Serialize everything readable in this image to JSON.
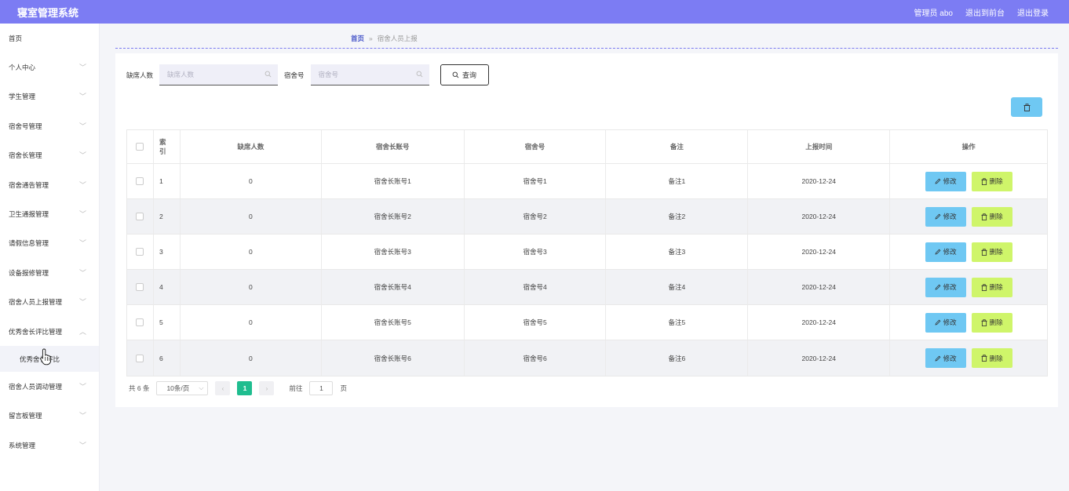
{
  "header": {
    "title": "寝室管理系统",
    "admin": "管理员 abo",
    "back_front": "退出到前台",
    "logout": "退出登录"
  },
  "sidebar": {
    "items": [
      {
        "label": "首页",
        "chevron": false
      },
      {
        "label": "个人中心",
        "chevron": true
      },
      {
        "label": "学生管理",
        "chevron": true
      },
      {
        "label": "宿舍号管理",
        "chevron": true
      },
      {
        "label": "宿舍长管理",
        "chevron": true
      },
      {
        "label": "宿舍通告管理",
        "chevron": true
      },
      {
        "label": "卫生通报管理",
        "chevron": true
      },
      {
        "label": "请假信息管理",
        "chevron": true
      },
      {
        "label": "设备报修管理",
        "chevron": true
      },
      {
        "label": "宿舍人员上报管理",
        "chevron": true
      },
      {
        "label": "优秀舍长评比管理",
        "chevron": true,
        "expanded": true
      }
    ],
    "sub_item": "优秀舍长评比",
    "items_after": [
      {
        "label": "宿舍人员调动管理"
      },
      {
        "label": "留言板管理"
      },
      {
        "label": "系统管理"
      }
    ]
  },
  "breadcrumb": {
    "home": "首页",
    "separator": "»",
    "current": "宿舍人员上报"
  },
  "search": {
    "field1_label": "缺席人数",
    "field1_placeholder": "缺席人数",
    "field2_label": "宿舍号",
    "field2_placeholder": "宿舍号",
    "query_label": "查询"
  },
  "table": {
    "headers": [
      "",
      "索引",
      "缺席人数",
      "宿舍长账号",
      "宿舍号",
      "备注",
      "上报时间",
      "操作"
    ],
    "rows": [
      {
        "idx": "1",
        "absent": "0",
        "account": "宿舍长账号1",
        "dorm": "宿舍号1",
        "note": "备注1",
        "time": "2020-12-24"
      },
      {
        "idx": "2",
        "absent": "0",
        "account": "宿舍长账号2",
        "dorm": "宿舍号2",
        "note": "备注2",
        "time": "2020-12-24"
      },
      {
        "idx": "3",
        "absent": "0",
        "account": "宿舍长账号3",
        "dorm": "宿舍号3",
        "note": "备注3",
        "time": "2020-12-24"
      },
      {
        "idx": "4",
        "absent": "0",
        "account": "宿舍长账号4",
        "dorm": "宿舍号4",
        "note": "备注4",
        "time": "2020-12-24"
      },
      {
        "idx": "5",
        "absent": "0",
        "account": "宿舍长账号5",
        "dorm": "宿舍号5",
        "note": "备注5",
        "time": "2020-12-24"
      },
      {
        "idx": "6",
        "absent": "0",
        "account": "宿舍长账号6",
        "dorm": "宿舍号6",
        "note": "备注6",
        "time": "2020-12-24"
      }
    ],
    "edit_label": "修改",
    "delete_label": "删除"
  },
  "pager": {
    "total": "共 6 条",
    "page_size": "10条/页",
    "current_page": "1",
    "goto_label": "前往",
    "goto_value": "1",
    "page_unit": "页"
  },
  "colors": {
    "header_bg": "#7c7cf3",
    "edit_btn": "#6fc8f3",
    "delete_btn": "#cff56a",
    "pager_active": "#1fbd8f"
  }
}
